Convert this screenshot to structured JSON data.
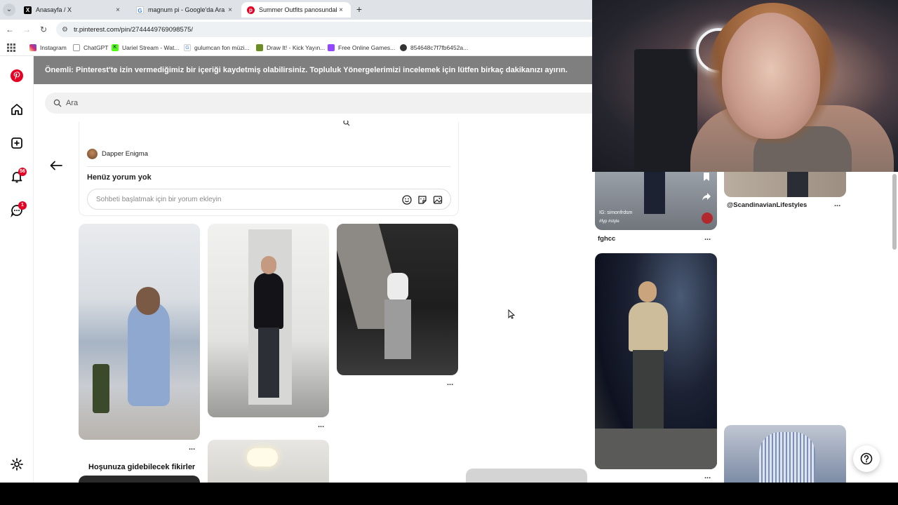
{
  "browser": {
    "tabs": [
      {
        "title": "Anasayfa / X",
        "favicon": "x-logo-icon"
      },
      {
        "title": "magnum pi - Google'da Ara",
        "favicon": "google-logo-icon"
      },
      {
        "title": "Summer Outfits panosundaki P",
        "favicon": "pinterest-logo-icon",
        "active": true
      }
    ],
    "url": "tr.pinterest.com/pin/2744449769098575/",
    "bookmarks": [
      {
        "label": "Instagram",
        "color": "#d6249f"
      },
      {
        "label": "ChatGPT",
        "color": "#ffffff"
      },
      {
        "label": "Uariel Stream - Wat...",
        "color": "#53fc18"
      },
      {
        "label": "gulumcan fon müzi...",
        "color": "#4285f4"
      },
      {
        "label": "Draw It! - Kick Yayın...",
        "color": "#6b8e23"
      },
      {
        "label": "Free Online Games...",
        "color": "#9146ff"
      },
      {
        "label": "854648c7f7fb6452a...",
        "color": "#333333"
      }
    ]
  },
  "rail": {
    "notifications_badge": "56",
    "messages_badge": "1",
    "brand_color": "#e60023"
  },
  "main": {
    "notice": "Önemli: Pinterest'te izin vermediğimiz bir içeriği kaydetmiş olabilirsiniz. Topluluk Yönergelerimizi incelemek için lütfen birkaç dakikanızı ayırın.",
    "search_placeholder": "Ara",
    "author": "Dapper Enigma",
    "comments_title": "Henüz yorum yok",
    "comment_placeholder": "Sohbeti başlatmak için bir yorum ekleyin",
    "more_label": "...",
    "section_title": "Hoşunuza gidebilecek fikirler"
  },
  "right": {
    "pin_overlay_handle": "IG: simonfrdsm",
    "pin_overlay_tags": "#fyp #style",
    "pin1_title": "fghcc",
    "pin2_title": "@ScandinavianLifestyles",
    "more_label": "..."
  }
}
